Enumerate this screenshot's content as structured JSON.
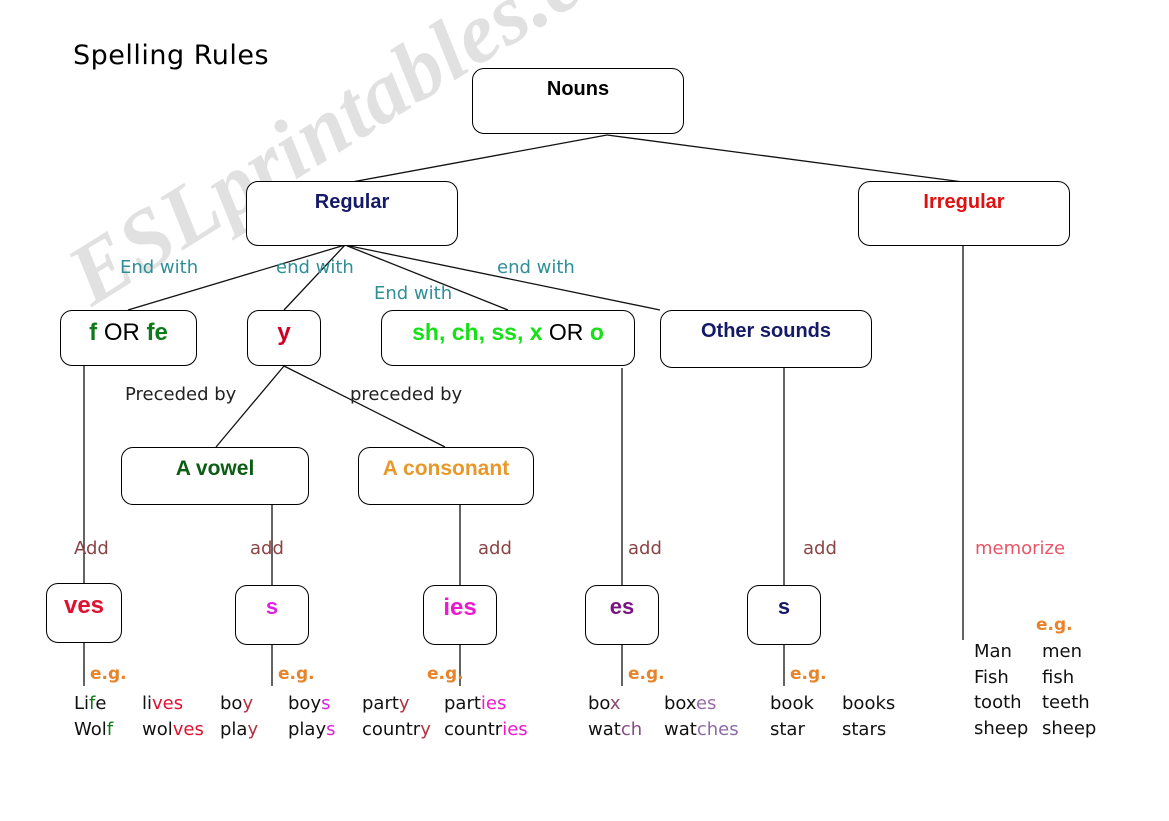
{
  "page": {
    "title": "Spelling Rules",
    "watermark": "ESLprintables.com",
    "background": "#ffffff"
  },
  "colors": {
    "black": "#000000",
    "navy": "#151a66",
    "red": "#e01010",
    "crimson": "#cc0022",
    "teal": "#2e8f96",
    "dark_green": "#0f7a1a",
    "bright_green": "#16e016",
    "orange": "#e8982a",
    "eg_orange": "#e8832a",
    "magenta": "#ee18cc",
    "purple": "#7a1482",
    "pink_red": "#e85566"
  },
  "nodes": {
    "nouns": {
      "label": "Nouns",
      "color": "#000000"
    },
    "regular": {
      "label": "Regular",
      "color": "#151a66"
    },
    "irregular": {
      "label": "Irregular",
      "color": "#e01010"
    },
    "f_or_fe": {
      "parts": [
        {
          "text": "f",
          "color": "#0f7a1a"
        },
        {
          "text": " OR ",
          "color": "#000000"
        },
        {
          "text": "fe",
          "color": "#0f7a1a"
        }
      ]
    },
    "y": {
      "label": "y",
      "color": "#cc0022"
    },
    "sh_ch_ss_x_or_o": {
      "parts": [
        {
          "text": "sh, ch, ss, x",
          "color": "#16e016"
        },
        {
          "text": " OR ",
          "color": "#000000"
        },
        {
          "text": "o",
          "color": "#16e016"
        }
      ]
    },
    "other_sounds": {
      "label": "Other sounds",
      "color": "#151a66"
    },
    "a_vowel": {
      "label": "A vowel",
      "color": "#0c5c14"
    },
    "a_consonant": {
      "label": "A consonant",
      "color": "#e8982a"
    },
    "suffix_ves": {
      "label": "ves",
      "color": "#e01030"
    },
    "suffix_s_vowel": {
      "label": "s",
      "color": "#dd22dd"
    },
    "suffix_ies": {
      "label": "ies",
      "color": "#ee18cc"
    },
    "suffix_es": {
      "label": "es",
      "color": "#7a1482"
    },
    "suffix_s_other": {
      "label": "s",
      "color": "#151a66"
    }
  },
  "edge_labels": {
    "end_with_1": {
      "text": "End with",
      "color": "#2e8f96"
    },
    "end_with_2": {
      "text": "end with",
      "color": "#2e8f96"
    },
    "end_with_3": {
      "text": "End with",
      "color": "#2e8f96"
    },
    "end_with_4": {
      "text": "end with",
      "color": "#2e8f96"
    },
    "preceded_by_1": {
      "text": "Preceded by",
      "color": "#222222"
    },
    "preceded_by_2": {
      "text": "preceded by",
      "color": "#222222"
    },
    "add_1": {
      "text": "Add",
      "color": "#8a4444"
    },
    "add_2": {
      "text": "add",
      "color": "#8a4444"
    },
    "add_3": {
      "text": "add",
      "color": "#8a4444"
    },
    "add_4": {
      "text": "add",
      "color": "#8a4444"
    },
    "add_5": {
      "text": "add",
      "color": "#8a4444"
    },
    "memorize": {
      "text": "memorize",
      "color": "#e85566"
    }
  },
  "eg_label": "e.g.",
  "examples": {
    "ves": {
      "rows": [
        {
          "singular": [
            {
              "t": "Li",
              "c": "#111111"
            },
            {
              "t": "f",
              "c": "#0f7a1a"
            },
            {
              "t": "e",
              "c": "#111111"
            }
          ],
          "plural": [
            {
              "t": "li",
              "c": "#111111"
            },
            {
              "t": "ves",
              "c": "#e01030"
            }
          ]
        },
        {
          "singular": [
            {
              "t": "Wol",
              "c": "#111111"
            },
            {
              "t": "f",
              "c": "#0f7a1a"
            }
          ],
          "plural": [
            {
              "t": "wol",
              "c": "#111111"
            },
            {
              "t": "ves",
              "c": "#e01030"
            }
          ]
        }
      ]
    },
    "s_vowel": {
      "rows": [
        {
          "singular": [
            {
              "t": "bo",
              "c": "#111111"
            },
            {
              "t": "y",
              "c": "#b03040"
            }
          ],
          "plural": [
            {
              "t": "boy",
              "c": "#111111"
            },
            {
              "t": "s",
              "c": "#dd22dd"
            }
          ]
        },
        {
          "singular": [
            {
              "t": "pla",
              "c": "#111111"
            },
            {
              "t": "y",
              "c": "#b03040"
            }
          ],
          "plural": [
            {
              "t": "play",
              "c": "#111111"
            },
            {
              "t": "s",
              "c": "#dd22dd"
            }
          ]
        }
      ]
    },
    "ies": {
      "rows": [
        {
          "singular": [
            {
              "t": "part",
              "c": "#111111"
            },
            {
              "t": "y",
              "c": "#b03040"
            }
          ],
          "plural": [
            {
              "t": "part",
              "c": "#111111"
            },
            {
              "t": "ies",
              "c": "#ee18cc"
            }
          ]
        },
        {
          "singular": [
            {
              "t": "countr",
              "c": "#111111"
            },
            {
              "t": "y",
              "c": "#b03040"
            }
          ],
          "plural": [
            {
              "t": "countr",
              "c": "#111111"
            },
            {
              "t": "ies",
              "c": "#ee18cc"
            }
          ]
        }
      ]
    },
    "es": {
      "rows": [
        {
          "singular": [
            {
              "t": "bo",
              "c": "#111111"
            },
            {
              "t": "x",
              "c": "#8a4a6a"
            }
          ],
          "plural": [
            {
              "t": "box",
              "c": "#111111"
            },
            {
              "t": "es",
              "c": "#9a6aa8"
            }
          ]
        },
        {
          "singular": [
            {
              "t": "wat",
              "c": "#111111"
            },
            {
              "t": "ch",
              "c": "#8a4a8a"
            }
          ],
          "plural": [
            {
              "t": "wat",
              "c": "#111111"
            },
            {
              "t": "ches",
              "c": "#8a6aa8"
            }
          ]
        }
      ]
    },
    "s_other": {
      "rows": [
        {
          "singular": [
            {
              "t": "book",
              "c": "#111111"
            }
          ],
          "plural": [
            {
              "t": "books",
              "c": "#111111"
            }
          ]
        },
        {
          "singular": [
            {
              "t": "star",
              "c": "#111111"
            }
          ],
          "plural": [
            {
              "t": "stars",
              "c": "#111111"
            }
          ]
        }
      ]
    },
    "irregular": {
      "rows": [
        {
          "singular": [
            {
              "t": "Man",
              "c": "#111111"
            }
          ],
          "plural": [
            {
              "t": "men",
              "c": "#111111"
            }
          ]
        },
        {
          "singular": [
            {
              "t": "Fish",
              "c": "#111111"
            }
          ],
          "plural": [
            {
              "t": "fish",
              "c": "#111111"
            }
          ]
        },
        {
          "singular": [
            {
              "t": "tooth",
              "c": "#111111"
            }
          ],
          "plural": [
            {
              "t": "teeth",
              "c": "#111111"
            }
          ]
        },
        {
          "singular": [
            {
              "t": "sheep",
              "c": "#111111"
            }
          ],
          "plural": [
            {
              "t": "sheep",
              "c": "#111111"
            }
          ]
        }
      ]
    }
  }
}
